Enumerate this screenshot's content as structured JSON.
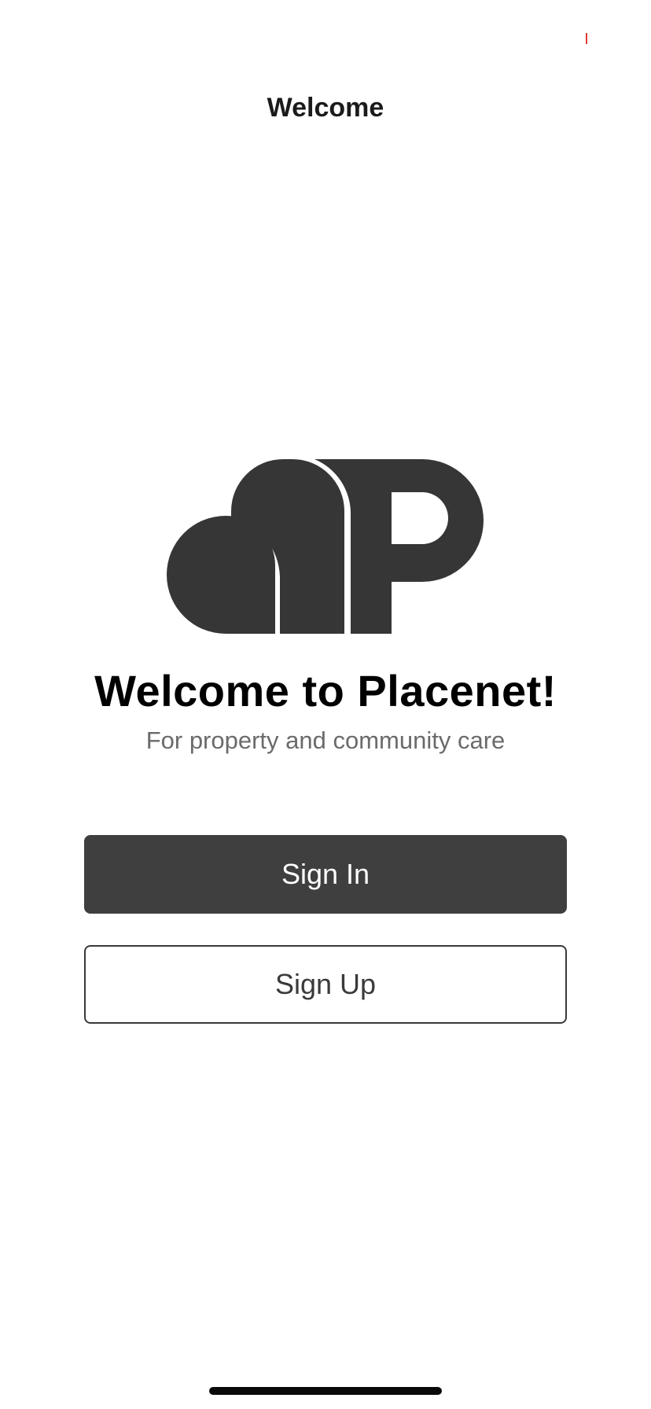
{
  "nav": {
    "title": "Welcome"
  },
  "logo": {
    "icon": "placenet-logo-icon",
    "color": "#363636"
  },
  "welcome": {
    "headline": "Welcome to Placenet!",
    "subtitle": "For property and community care"
  },
  "actions": {
    "sign_in_label": "Sign In",
    "sign_up_label": "Sign Up"
  },
  "colors": {
    "primary_button": "#3f3f3f",
    "status_marker": "#e53935"
  }
}
